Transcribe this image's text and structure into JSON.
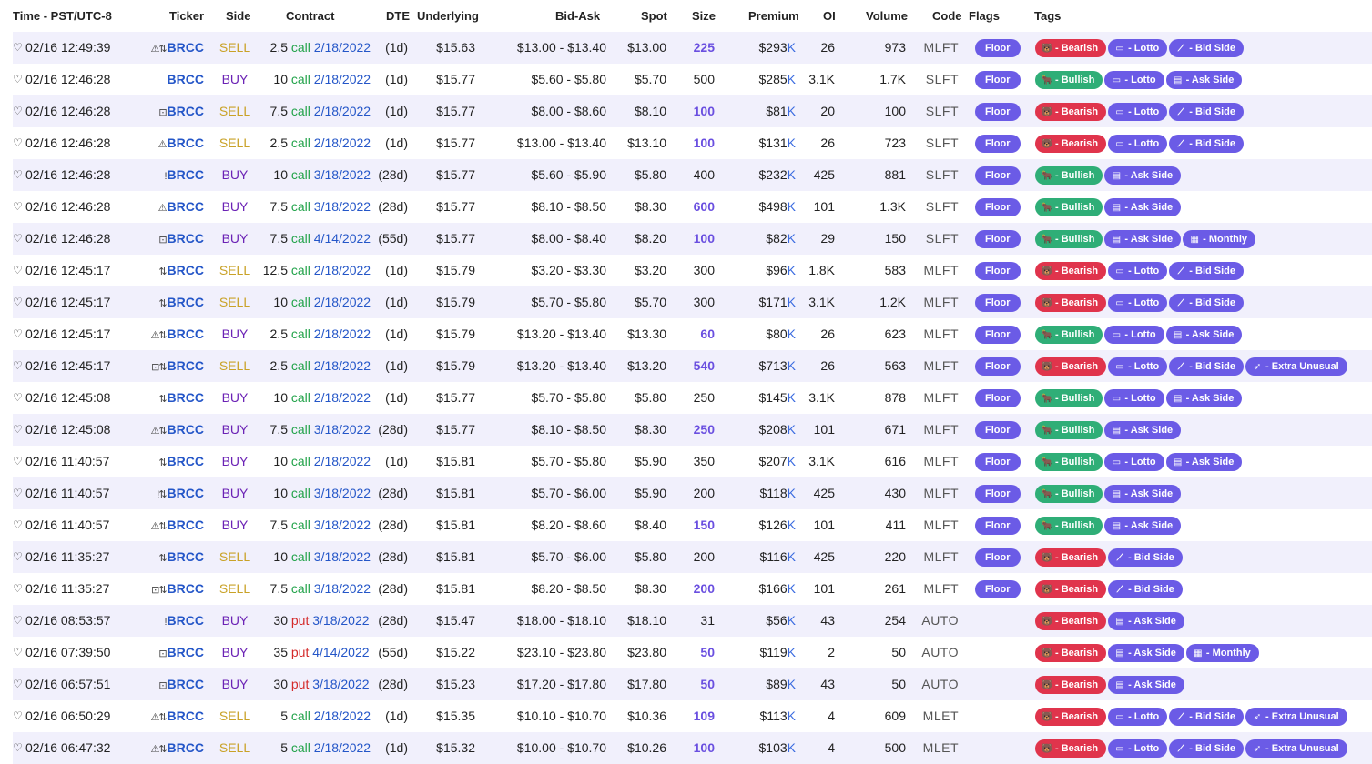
{
  "headers": {
    "time": "Time - PST/UTC-8",
    "ticker": "Ticker",
    "side": "Side",
    "contract": "Contract",
    "dte": "DTE",
    "underlying": "Underlying",
    "bid_ask": "Bid-Ask",
    "spot": "Spot",
    "size": "Size",
    "premium": "Premium",
    "oi": "OI",
    "volume": "Volume",
    "code": "Code",
    "flags": "Flags",
    "tags": "Tags"
  },
  "colors": {
    "sell": "#c9a227",
    "buy": "#6b22b5",
    "call": "#22a34a",
    "put": "#d42a2a",
    "link": "#2456c8",
    "bearish": "#e0344c",
    "bullish": "#2fae77",
    "purple": "#6b5be6",
    "row_alt": "#f1f0fc"
  },
  "tag_icons": {
    "Bearish": "bear-icon",
    "Bullish": "bull-icon",
    "Lotto": "lotto-screen-icon",
    "Bid Side": "bid-hammer-icon",
    "Ask Side": "ask-clipboard-icon",
    "Monthly": "calendar-icon",
    "Extra Unusual": "rocket-icon"
  },
  "rows": [
    {
      "time": "02/16 12:49:39",
      "icons": "⚠⇅",
      "ticker": "BRCC",
      "side": "SELL",
      "qty": "2.5",
      "type": "call",
      "exp": "2/18/2022",
      "dte": "(1d)",
      "underlying": "$15.63",
      "bid_ask": "$13.00 - $13.40",
      "spot": "$13.00",
      "size": "225",
      "size_hi": true,
      "premium": "$293",
      "premium_unit": "K",
      "oi": "26",
      "volume": "973",
      "code": "MLFT",
      "flag": "Floor",
      "tags": [
        "Bearish",
        "Lotto",
        "Bid Side"
      ]
    },
    {
      "time": "02/16 12:46:28",
      "icons": "",
      "ticker": "BRCC",
      "side": "BUY",
      "qty": "10",
      "type": "call",
      "exp": "2/18/2022",
      "dte": "(1d)",
      "underlying": "$15.77",
      "bid_ask": "$5.60 - $5.80",
      "spot": "$5.70",
      "size": "500",
      "size_hi": false,
      "premium": "$285",
      "premium_unit": "K",
      "oi": "3.1K",
      "volume": "1.7K",
      "code": "SLFT",
      "flag": "Floor",
      "tags": [
        "Bullish",
        "Lotto",
        "Ask Side"
      ]
    },
    {
      "time": "02/16 12:46:28",
      "icons": "⊡",
      "ticker": "BRCC",
      "side": "SELL",
      "qty": "7.5",
      "type": "call",
      "exp": "2/18/2022",
      "dte": "(1d)",
      "underlying": "$15.77",
      "bid_ask": "$8.00 - $8.60",
      "spot": "$8.10",
      "size": "100",
      "size_hi": true,
      "premium": "$81",
      "premium_unit": "K",
      "oi": "20",
      "volume": "100",
      "code": "SLFT",
      "flag": "Floor",
      "tags": [
        "Bearish",
        "Lotto",
        "Bid Side"
      ]
    },
    {
      "time": "02/16 12:46:28",
      "icons": "⚠",
      "ticker": "BRCC",
      "side": "SELL",
      "qty": "2.5",
      "type": "call",
      "exp": "2/18/2022",
      "dte": "(1d)",
      "underlying": "$15.77",
      "bid_ask": "$13.00 - $13.40",
      "spot": "$13.10",
      "size": "100",
      "size_hi": true,
      "premium": "$131",
      "premium_unit": "K",
      "oi": "26",
      "volume": "723",
      "code": "SLFT",
      "flag": "Floor",
      "tags": [
        "Bearish",
        "Lotto",
        "Bid Side"
      ]
    },
    {
      "time": "02/16 12:46:28",
      "icons": "!",
      "ticker": "BRCC",
      "side": "BUY",
      "qty": "10",
      "type": "call",
      "exp": "3/18/2022",
      "dte": "(28d)",
      "underlying": "$15.77",
      "bid_ask": "$5.60 - $5.90",
      "spot": "$5.80",
      "size": "400",
      "size_hi": false,
      "premium": "$232",
      "premium_unit": "K",
      "oi": "425",
      "volume": "881",
      "code": "SLFT",
      "flag": "Floor",
      "tags": [
        "Bullish",
        "Ask Side"
      ]
    },
    {
      "time": "02/16 12:46:28",
      "icons": "⚠",
      "ticker": "BRCC",
      "side": "BUY",
      "qty": "7.5",
      "type": "call",
      "exp": "3/18/2022",
      "dte": "(28d)",
      "underlying": "$15.77",
      "bid_ask": "$8.10 - $8.50",
      "spot": "$8.30",
      "size": "600",
      "size_hi": true,
      "premium": "$498",
      "premium_unit": "K",
      "oi": "101",
      "volume": "1.3K",
      "code": "SLFT",
      "flag": "Floor",
      "tags": [
        "Bullish",
        "Ask Side"
      ]
    },
    {
      "time": "02/16 12:46:28",
      "icons": "⊡",
      "ticker": "BRCC",
      "side": "BUY",
      "qty": "7.5",
      "type": "call",
      "exp": "4/14/2022",
      "dte": "(55d)",
      "underlying": "$15.77",
      "bid_ask": "$8.00 - $8.40",
      "spot": "$8.20",
      "size": "100",
      "size_hi": true,
      "premium": "$82",
      "premium_unit": "K",
      "oi": "29",
      "volume": "150",
      "code": "SLFT",
      "flag": "Floor",
      "tags": [
        "Bullish",
        "Ask Side",
        "Monthly"
      ]
    },
    {
      "time": "02/16 12:45:17",
      "icons": "⇅",
      "ticker": "BRCC",
      "side": "SELL",
      "qty": "12.5",
      "type": "call",
      "exp": "2/18/2022",
      "dte": "(1d)",
      "underlying": "$15.79",
      "bid_ask": "$3.20 - $3.30",
      "spot": "$3.20",
      "size": "300",
      "size_hi": false,
      "premium": "$96",
      "premium_unit": "K",
      "oi": "1.8K",
      "volume": "583",
      "code": "MLFT",
      "flag": "Floor",
      "tags": [
        "Bearish",
        "Lotto",
        "Bid Side"
      ]
    },
    {
      "time": "02/16 12:45:17",
      "icons": "⇅",
      "ticker": "BRCC",
      "side": "SELL",
      "qty": "10",
      "type": "call",
      "exp": "2/18/2022",
      "dte": "(1d)",
      "underlying": "$15.79",
      "bid_ask": "$5.70 - $5.80",
      "spot": "$5.70",
      "size": "300",
      "size_hi": false,
      "premium": "$171",
      "premium_unit": "K",
      "oi": "3.1K",
      "volume": "1.2K",
      "code": "MLFT",
      "flag": "Floor",
      "tags": [
        "Bearish",
        "Lotto",
        "Bid Side"
      ]
    },
    {
      "time": "02/16 12:45:17",
      "icons": "⚠⇅",
      "ticker": "BRCC",
      "side": "BUY",
      "qty": "2.5",
      "type": "call",
      "exp": "2/18/2022",
      "dte": "(1d)",
      "underlying": "$15.79",
      "bid_ask": "$13.20 - $13.40",
      "spot": "$13.30",
      "size": "60",
      "size_hi": true,
      "premium": "$80",
      "premium_unit": "K",
      "oi": "26",
      "volume": "623",
      "code": "MLFT",
      "flag": "Floor",
      "tags": [
        "Bullish",
        "Lotto",
        "Ask Side"
      ]
    },
    {
      "time": "02/16 12:45:17",
      "icons": "⊡⇅",
      "ticker": "BRCC",
      "side": "SELL",
      "qty": "2.5",
      "type": "call",
      "exp": "2/18/2022",
      "dte": "(1d)",
      "underlying": "$15.79",
      "bid_ask": "$13.20 - $13.40",
      "spot": "$13.20",
      "size": "540",
      "size_hi": true,
      "premium": "$713",
      "premium_unit": "K",
      "oi": "26",
      "volume": "563",
      "code": "MLFT",
      "flag": "Floor",
      "tags": [
        "Bearish",
        "Lotto",
        "Bid Side",
        "Extra Unusual"
      ]
    },
    {
      "time": "02/16 12:45:08",
      "icons": "⇅",
      "ticker": "BRCC",
      "side": "BUY",
      "qty": "10",
      "type": "call",
      "exp": "2/18/2022",
      "dte": "(1d)",
      "underlying": "$15.77",
      "bid_ask": "$5.70 - $5.80",
      "spot": "$5.80",
      "size": "250",
      "size_hi": false,
      "premium": "$145",
      "premium_unit": "K",
      "oi": "3.1K",
      "volume": "878",
      "code": "MLFT",
      "flag": "Floor",
      "tags": [
        "Bullish",
        "Lotto",
        "Ask Side"
      ]
    },
    {
      "time": "02/16 12:45:08",
      "icons": "⚠⇅",
      "ticker": "BRCC",
      "side": "BUY",
      "qty": "7.5",
      "type": "call",
      "exp": "3/18/2022",
      "dte": "(28d)",
      "underlying": "$15.77",
      "bid_ask": "$8.10 - $8.50",
      "spot": "$8.30",
      "size": "250",
      "size_hi": true,
      "premium": "$208",
      "premium_unit": "K",
      "oi": "101",
      "volume": "671",
      "code": "MLFT",
      "flag": "Floor",
      "tags": [
        "Bullish",
        "Ask Side"
      ]
    },
    {
      "time": "02/16 11:40:57",
      "icons": "⇅",
      "ticker": "BRCC",
      "side": "BUY",
      "qty": "10",
      "type": "call",
      "exp": "2/18/2022",
      "dte": "(1d)",
      "underlying": "$15.81",
      "bid_ask": "$5.70 - $5.80",
      "spot": "$5.90",
      "size": "350",
      "size_hi": false,
      "premium": "$207",
      "premium_unit": "K",
      "oi": "3.1K",
      "volume": "616",
      "code": "MLFT",
      "flag": "Floor",
      "tags": [
        "Bullish",
        "Lotto",
        "Ask Side"
      ]
    },
    {
      "time": "02/16 11:40:57",
      "icons": "!⇅",
      "ticker": "BRCC",
      "side": "BUY",
      "qty": "10",
      "type": "call",
      "exp": "3/18/2022",
      "dte": "(28d)",
      "underlying": "$15.81",
      "bid_ask": "$5.70 - $6.00",
      "spot": "$5.90",
      "size": "200",
      "size_hi": false,
      "premium": "$118",
      "premium_unit": "K",
      "oi": "425",
      "volume": "430",
      "code": "MLFT",
      "flag": "Floor",
      "tags": [
        "Bullish",
        "Ask Side"
      ]
    },
    {
      "time": "02/16 11:40:57",
      "icons": "⚠⇅",
      "ticker": "BRCC",
      "side": "BUY",
      "qty": "7.5",
      "type": "call",
      "exp": "3/18/2022",
      "dte": "(28d)",
      "underlying": "$15.81",
      "bid_ask": "$8.20 - $8.60",
      "spot": "$8.40",
      "size": "150",
      "size_hi": true,
      "premium": "$126",
      "premium_unit": "K",
      "oi": "101",
      "volume": "411",
      "code": "MLFT",
      "flag": "Floor",
      "tags": [
        "Bullish",
        "Ask Side"
      ]
    },
    {
      "time": "02/16 11:35:27",
      "icons": "⇅",
      "ticker": "BRCC",
      "side": "SELL",
      "qty": "10",
      "type": "call",
      "exp": "3/18/2022",
      "dte": "(28d)",
      "underlying": "$15.81",
      "bid_ask": "$5.70 - $6.00",
      "spot": "$5.80",
      "size": "200",
      "size_hi": false,
      "premium": "$116",
      "premium_unit": "K",
      "oi": "425",
      "volume": "220",
      "code": "MLFT",
      "flag": "Floor",
      "tags": [
        "Bearish",
        "Bid Side"
      ]
    },
    {
      "time": "02/16 11:35:27",
      "icons": "⊡⇅",
      "ticker": "BRCC",
      "side": "SELL",
      "qty": "7.5",
      "type": "call",
      "exp": "3/18/2022",
      "dte": "(28d)",
      "underlying": "$15.81",
      "bid_ask": "$8.20 - $8.50",
      "spot": "$8.30",
      "size": "200",
      "size_hi": true,
      "premium": "$166",
      "premium_unit": "K",
      "oi": "101",
      "volume": "261",
      "code": "MLFT",
      "flag": "Floor",
      "tags": [
        "Bearish",
        "Bid Side"
      ]
    },
    {
      "time": "02/16 08:53:57",
      "icons": "!",
      "ticker": "BRCC",
      "side": "BUY",
      "qty": "30",
      "type": "put",
      "exp": "3/18/2022",
      "dte": "(28d)",
      "underlying": "$15.47",
      "bid_ask": "$18.00 - $18.10",
      "spot": "$18.10",
      "size": "31",
      "size_hi": false,
      "premium": "$56",
      "premium_unit": "K",
      "oi": "43",
      "volume": "254",
      "code": "AUTO",
      "flag": "",
      "tags": [
        "Bearish",
        "Ask Side"
      ]
    },
    {
      "time": "02/16 07:39:50",
      "icons": "⊡",
      "ticker": "BRCC",
      "side": "BUY",
      "qty": "35",
      "type": "put",
      "exp": "4/14/2022",
      "dte": "(55d)",
      "underlying": "$15.22",
      "bid_ask": "$23.10 - $23.80",
      "spot": "$23.80",
      "size": "50",
      "size_hi": true,
      "premium": "$119",
      "premium_unit": "K",
      "oi": "2",
      "volume": "50",
      "code": "AUTO",
      "flag": "",
      "tags": [
        "Bearish",
        "Ask Side",
        "Monthly"
      ]
    },
    {
      "time": "02/16 06:57:51",
      "icons": "⊡",
      "ticker": "BRCC",
      "side": "BUY",
      "qty": "30",
      "type": "put",
      "exp": "3/18/2022",
      "dte": "(28d)",
      "underlying": "$15.23",
      "bid_ask": "$17.20 - $17.80",
      "spot": "$17.80",
      "size": "50",
      "size_hi": true,
      "premium": "$89",
      "premium_unit": "K",
      "oi": "43",
      "volume": "50",
      "code": "AUTO",
      "flag": "",
      "tags": [
        "Bearish",
        "Ask Side"
      ]
    },
    {
      "time": "02/16 06:50:29",
      "icons": "⚠⇅",
      "ticker": "BRCC",
      "side": "SELL",
      "qty": "5",
      "type": "call",
      "exp": "2/18/2022",
      "dte": "(1d)",
      "underlying": "$15.35",
      "bid_ask": "$10.10 - $10.70",
      "spot": "$10.36",
      "size": "109",
      "size_hi": true,
      "premium": "$113",
      "premium_unit": "K",
      "oi": "4",
      "volume": "609",
      "code": "MLET",
      "flag": "",
      "tags": [
        "Bearish",
        "Lotto",
        "Bid Side",
        "Extra Unusual"
      ]
    },
    {
      "time": "02/16 06:47:32",
      "icons": "⚠⇅",
      "ticker": "BRCC",
      "side": "SELL",
      "qty": "5",
      "type": "call",
      "exp": "2/18/2022",
      "dte": "(1d)",
      "underlying": "$15.32",
      "bid_ask": "$10.00 - $10.70",
      "spot": "$10.26",
      "size": "100",
      "size_hi": true,
      "premium": "$103",
      "premium_unit": "K",
      "oi": "4",
      "volume": "500",
      "code": "MLET",
      "flag": "",
      "tags": [
        "Bearish",
        "Lotto",
        "Bid Side",
        "Extra Unusual"
      ]
    }
  ]
}
